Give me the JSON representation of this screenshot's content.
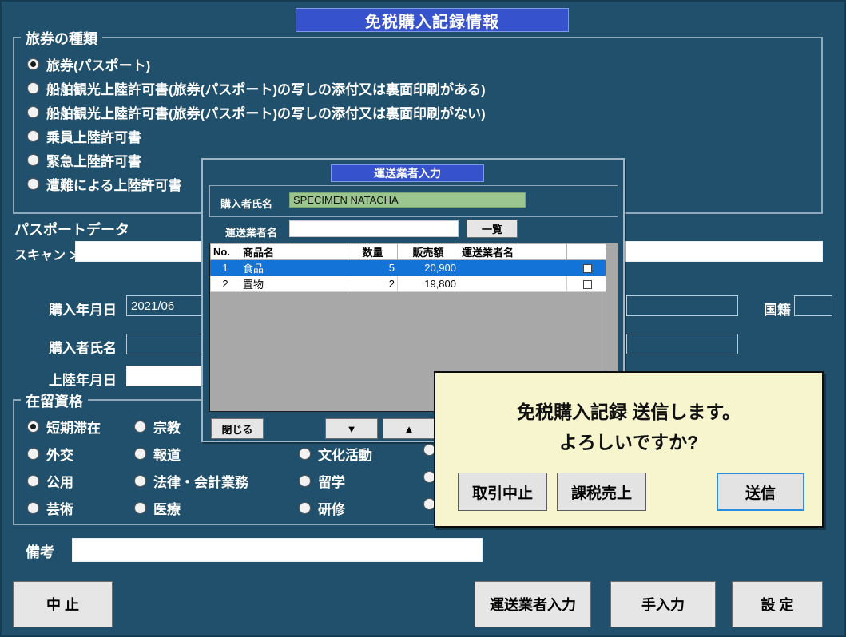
{
  "window": {
    "title": "免税購入記録情報"
  },
  "passport_type": {
    "legend": "旅券の種類",
    "options": [
      {
        "label": "旅券(パスポート)",
        "selected": true
      },
      {
        "label": "船舶観光上陸許可書(旅券(パスポート)の写しの添付又は裏面印刷がある)",
        "selected": false
      },
      {
        "label": "船舶観光上陸許可書(旅券(パスポート)の写しの添付又は裏面印刷がない)",
        "selected": false
      },
      {
        "label": "乗員上陸許可書",
        "selected": false
      },
      {
        "label": "緊急上陸許可書",
        "selected": false
      },
      {
        "label": "遭難による上陸許可書",
        "selected": false
      }
    ]
  },
  "passport_data": {
    "section_label": "パスポートデータ",
    "scan_label": "スキャン ≫",
    "scan_value": "",
    "fields": [
      {
        "label": "購入年月日",
        "value": "2021/06"
      },
      {
        "label": "購入者氏名",
        "value": ""
      },
      {
        "label": "上陸年月日",
        "value": ""
      }
    ],
    "nationality_label": "国籍",
    "nationality_value": ""
  },
  "residence_status": {
    "legend": "在留資格",
    "col1": [
      {
        "label": "短期滞在",
        "selected": true
      },
      {
        "label": "外交",
        "selected": false
      },
      {
        "label": "公用",
        "selected": false
      },
      {
        "label": "芸術",
        "selected": false
      }
    ],
    "col2": [
      {
        "label": "宗教",
        "selected": false
      },
      {
        "label": "報道",
        "selected": false
      },
      {
        "label": "法律・会計業務",
        "selected": false
      },
      {
        "label": "医療",
        "selected": false
      }
    ],
    "col3": [
      {
        "label": "文化活動",
        "selected": false
      },
      {
        "label": "留学",
        "selected": false
      },
      {
        "label": "研修",
        "selected": false
      }
    ],
    "col4": [
      {
        "label": "",
        "selected": false
      },
      {
        "label": "",
        "selected": false
      },
      {
        "label": "",
        "selected": false
      }
    ]
  },
  "remarks": {
    "label": "備考",
    "value": ""
  },
  "footer_buttons": [
    {
      "name": "cancel",
      "label": "中 止"
    },
    {
      "name": "carrier-input",
      "label": "運送業者入力"
    },
    {
      "name": "manual-input",
      "label": "手入力"
    },
    {
      "name": "settings",
      "label": "設 定"
    }
  ],
  "carrier_modal": {
    "title": "運送業者入力",
    "buyer_name_label": "購入者氏名",
    "buyer_name_value": "SPECIMEN NATACHA",
    "carrier_name_label": "運送業者名",
    "carrier_name_value": "",
    "list_button_label": "一覧",
    "table": {
      "headers": [
        "No.",
        "商品名",
        "数量",
        "販売額",
        "運送業者名",
        ""
      ],
      "rows": [
        {
          "no": "1",
          "product": "食品",
          "qty": "5",
          "amount": "20,900",
          "carrier": "",
          "checked": true,
          "selected": true
        },
        {
          "no": "2",
          "product": "置物",
          "qty": "2",
          "amount": "19,800",
          "carrier": "",
          "checked": false,
          "selected": false
        }
      ]
    },
    "close_label": "閉じる",
    "down_label": "▼",
    "up_label": "▲"
  },
  "confirm_dialog": {
    "message_line1": "免税購入記録 送信します。",
    "message_line2": "よろしいですか?",
    "buttons": [
      {
        "name": "abort-transaction",
        "label": "取引中止",
        "focused": false
      },
      {
        "name": "taxable-sale",
        "label": "課税売上",
        "focused": false
      },
      {
        "name": "send",
        "label": "送信",
        "focused": true
      }
    ]
  },
  "colors": {
    "background": "#21506c",
    "title_blue": "#3652cc",
    "dialog_yellow": "#f7f5cd",
    "selected_row_blue": "#1473d6",
    "buyer_field_green": "#9cc68f",
    "list_grey": "#a8a8a8"
  }
}
